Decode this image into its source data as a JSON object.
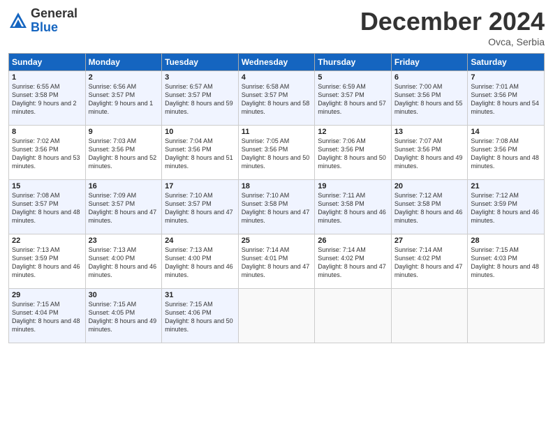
{
  "header": {
    "logo_general": "General",
    "logo_blue": "Blue",
    "month_title": "December 2024",
    "location": "Ovca, Serbia"
  },
  "days_of_week": [
    "Sunday",
    "Monday",
    "Tuesday",
    "Wednesday",
    "Thursday",
    "Friday",
    "Saturday"
  ],
  "weeks": [
    [
      {
        "day": "1",
        "sunrise": "6:55 AM",
        "sunset": "3:58 PM",
        "daylight": "9 hours and 2 minutes."
      },
      {
        "day": "2",
        "sunrise": "6:56 AM",
        "sunset": "3:57 PM",
        "daylight": "9 hours and 1 minute."
      },
      {
        "day": "3",
        "sunrise": "6:57 AM",
        "sunset": "3:57 PM",
        "daylight": "8 hours and 59 minutes."
      },
      {
        "day": "4",
        "sunrise": "6:58 AM",
        "sunset": "3:57 PM",
        "daylight": "8 hours and 58 minutes."
      },
      {
        "day": "5",
        "sunrise": "6:59 AM",
        "sunset": "3:57 PM",
        "daylight": "8 hours and 57 minutes."
      },
      {
        "day": "6",
        "sunrise": "7:00 AM",
        "sunset": "3:56 PM",
        "daylight": "8 hours and 55 minutes."
      },
      {
        "day": "7",
        "sunrise": "7:01 AM",
        "sunset": "3:56 PM",
        "daylight": "8 hours and 54 minutes."
      }
    ],
    [
      {
        "day": "8",
        "sunrise": "7:02 AM",
        "sunset": "3:56 PM",
        "daylight": "8 hours and 53 minutes."
      },
      {
        "day": "9",
        "sunrise": "7:03 AM",
        "sunset": "3:56 PM",
        "daylight": "8 hours and 52 minutes."
      },
      {
        "day": "10",
        "sunrise": "7:04 AM",
        "sunset": "3:56 PM",
        "daylight": "8 hours and 51 minutes."
      },
      {
        "day": "11",
        "sunrise": "7:05 AM",
        "sunset": "3:56 PM",
        "daylight": "8 hours and 50 minutes."
      },
      {
        "day": "12",
        "sunrise": "7:06 AM",
        "sunset": "3:56 PM",
        "daylight": "8 hours and 50 minutes."
      },
      {
        "day": "13",
        "sunrise": "7:07 AM",
        "sunset": "3:56 PM",
        "daylight": "8 hours and 49 minutes."
      },
      {
        "day": "14",
        "sunrise": "7:08 AM",
        "sunset": "3:56 PM",
        "daylight": "8 hours and 48 minutes."
      }
    ],
    [
      {
        "day": "15",
        "sunrise": "7:08 AM",
        "sunset": "3:57 PM",
        "daylight": "8 hours and 48 minutes."
      },
      {
        "day": "16",
        "sunrise": "7:09 AM",
        "sunset": "3:57 PM",
        "daylight": "8 hours and 47 minutes."
      },
      {
        "day": "17",
        "sunrise": "7:10 AM",
        "sunset": "3:57 PM",
        "daylight": "8 hours and 47 minutes."
      },
      {
        "day": "18",
        "sunrise": "7:10 AM",
        "sunset": "3:58 PM",
        "daylight": "8 hours and 47 minutes."
      },
      {
        "day": "19",
        "sunrise": "7:11 AM",
        "sunset": "3:58 PM",
        "daylight": "8 hours and 46 minutes."
      },
      {
        "day": "20",
        "sunrise": "7:12 AM",
        "sunset": "3:58 PM",
        "daylight": "8 hours and 46 minutes."
      },
      {
        "day": "21",
        "sunrise": "7:12 AM",
        "sunset": "3:59 PM",
        "daylight": "8 hours and 46 minutes."
      }
    ],
    [
      {
        "day": "22",
        "sunrise": "7:13 AM",
        "sunset": "3:59 PM",
        "daylight": "8 hours and 46 minutes."
      },
      {
        "day": "23",
        "sunrise": "7:13 AM",
        "sunset": "4:00 PM",
        "daylight": "8 hours and 46 minutes."
      },
      {
        "day": "24",
        "sunrise": "7:13 AM",
        "sunset": "4:00 PM",
        "daylight": "8 hours and 46 minutes."
      },
      {
        "day": "25",
        "sunrise": "7:14 AM",
        "sunset": "4:01 PM",
        "daylight": "8 hours and 47 minutes."
      },
      {
        "day": "26",
        "sunrise": "7:14 AM",
        "sunset": "4:02 PM",
        "daylight": "8 hours and 47 minutes."
      },
      {
        "day": "27",
        "sunrise": "7:14 AM",
        "sunset": "4:02 PM",
        "daylight": "8 hours and 47 minutes."
      },
      {
        "day": "28",
        "sunrise": "7:15 AM",
        "sunset": "4:03 PM",
        "daylight": "8 hours and 48 minutes."
      }
    ],
    [
      {
        "day": "29",
        "sunrise": "7:15 AM",
        "sunset": "4:04 PM",
        "daylight": "8 hours and 48 minutes."
      },
      {
        "day": "30",
        "sunrise": "7:15 AM",
        "sunset": "4:05 PM",
        "daylight": "8 hours and 49 minutes."
      },
      {
        "day": "31",
        "sunrise": "7:15 AM",
        "sunset": "4:06 PM",
        "daylight": "8 hours and 50 minutes."
      },
      null,
      null,
      null,
      null
    ]
  ]
}
